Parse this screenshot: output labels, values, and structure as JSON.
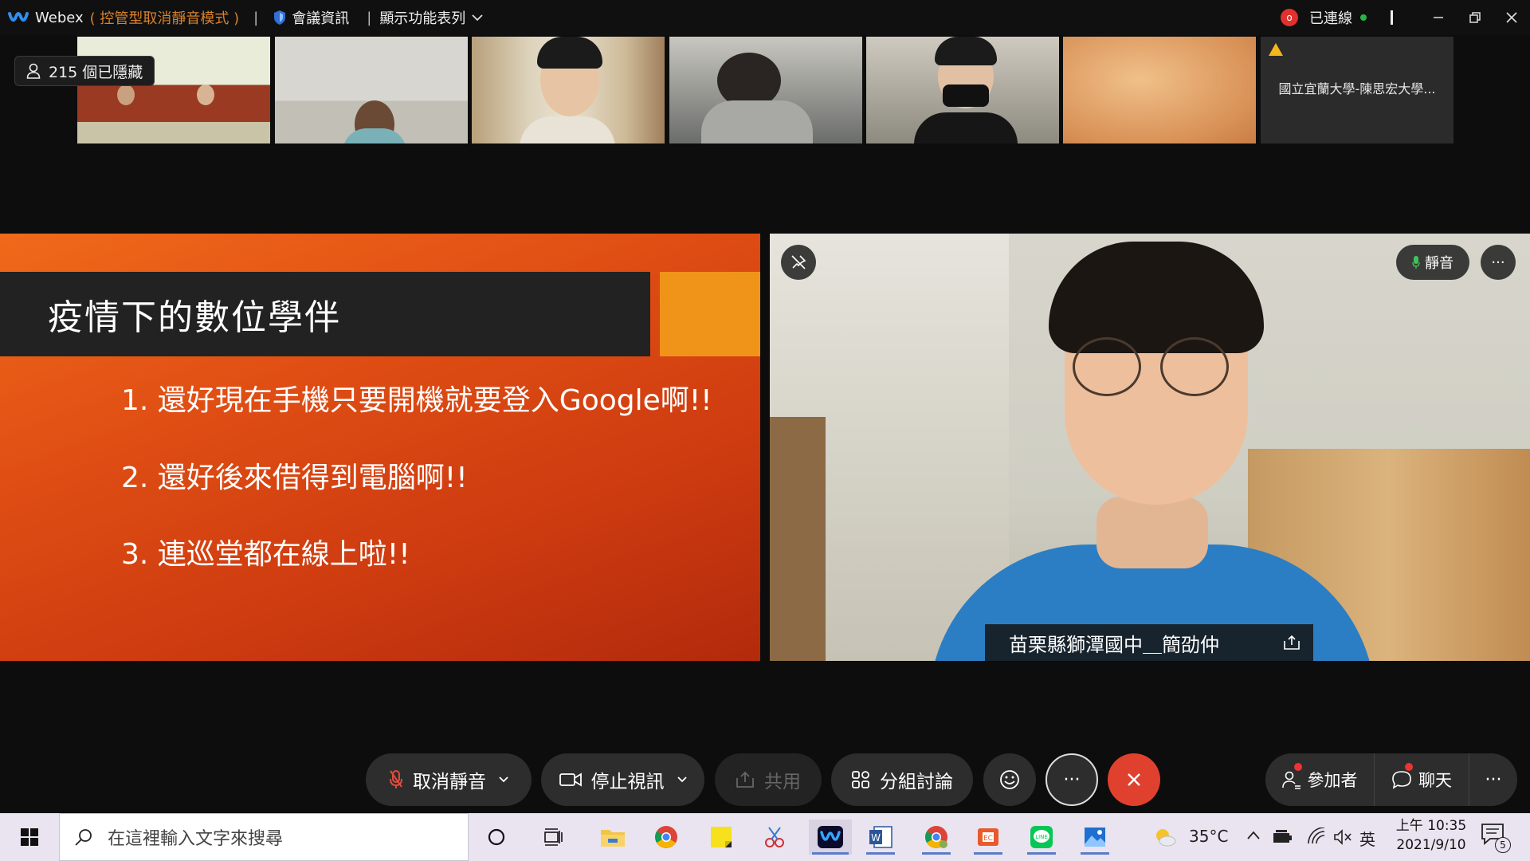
{
  "titlebar": {
    "app_name": "Webex",
    "mode": "( 控管型取消靜音模式 )",
    "sep": "|",
    "meeting_info": "會議資訊",
    "show_menu": "顯示功能表列",
    "rec_label": "o",
    "connected": "已連線"
  },
  "participants": {
    "hidden_count": "215 個已隱藏",
    "last_tile_name": "國立宜蘭大學-陳思宏大學..."
  },
  "slide": {
    "title": "疫情下的數位學伴",
    "bullets": [
      "1. 還好現在手機只要開機就要登入Google啊!!",
      "2. 還好後來借得到電腦啊!!",
      "3. 連巡堂都在線上啦!!"
    ]
  },
  "speaker": {
    "mute_label": "靜音",
    "more": "···",
    "name": "苗栗縣獅潭國中＿簡劭仲"
  },
  "controls": {
    "unmute": "取消靜音",
    "stop_video": "停止視訊",
    "share": "共用",
    "breakout": "分組討論",
    "more": "···",
    "participants": "參加者",
    "chat": "聊天",
    "right_more": "···"
  },
  "taskbar": {
    "search_placeholder": "在這裡輸入文字來搜尋",
    "weather": "35°C",
    "ime": "英",
    "time": "上午 10:35",
    "date": "2021/9/10",
    "notif_count": "5"
  },
  "colors": {
    "end_call": "#e0412e",
    "mode_text": "#d9822b",
    "slide_accent": "#ef9419"
  }
}
